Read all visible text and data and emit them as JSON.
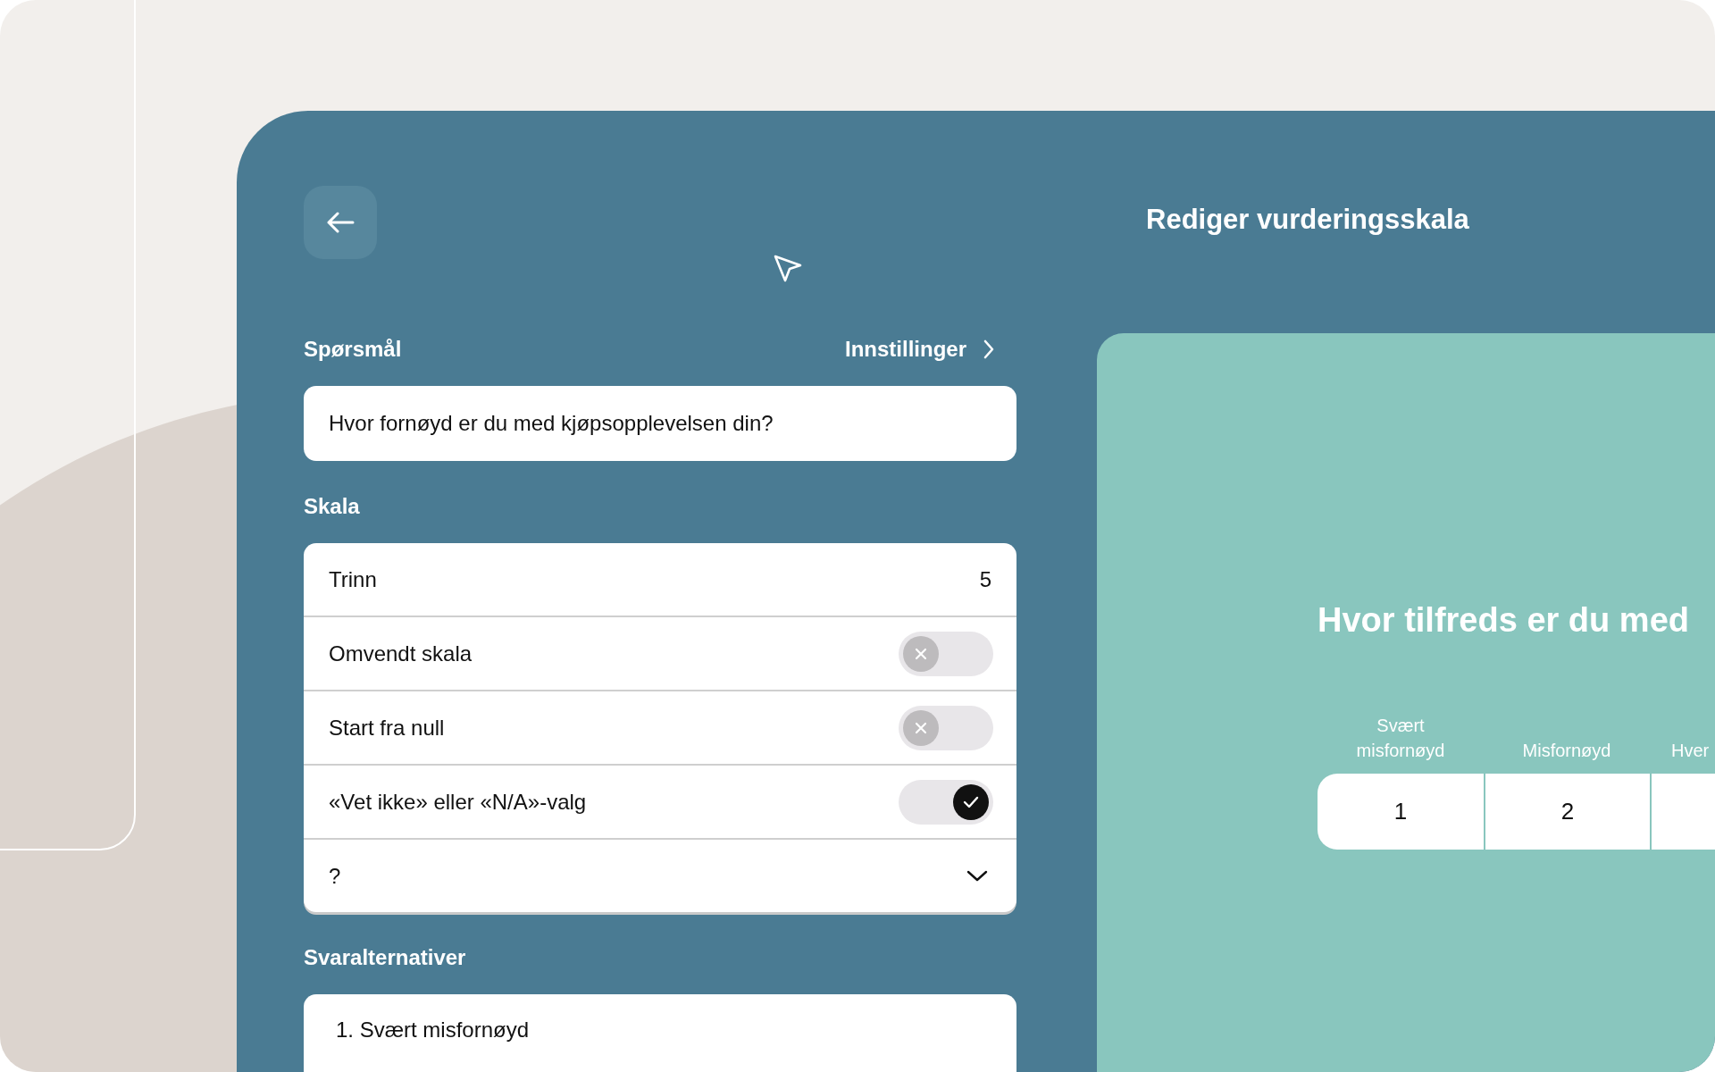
{
  "title": "Rediger vurderingsskala",
  "question_section": {
    "label": "Spørsmål",
    "settings_link": "Innstillinger",
    "question": "Hvor fornøyd er du med kjøpsopplevelsen din?"
  },
  "scale_section": {
    "label": "Skala",
    "rows": [
      {
        "kind": "value",
        "label": "Trinn",
        "value": "5"
      },
      {
        "kind": "toggle",
        "label": "Omvendt skala",
        "on": false
      },
      {
        "kind": "toggle",
        "label": "Start fra null",
        "on": false
      },
      {
        "kind": "toggle",
        "label": "«Vet ikke» eller «N/A»-valg",
        "on": true
      },
      {
        "kind": "dropdown",
        "label": "?",
        "expanded": false
      }
    ]
  },
  "answers_section": {
    "label": "Svaralternativer",
    "options": [
      "1. Svært misfornøyd"
    ]
  },
  "preview": {
    "question": "Hvor tilfreds er du med",
    "scale": [
      {
        "label": "Svært misfornøyd",
        "value": "1"
      },
      {
        "label": "Misfornøyd",
        "value": "2"
      },
      {
        "label": "Hver"
      }
    ]
  }
}
